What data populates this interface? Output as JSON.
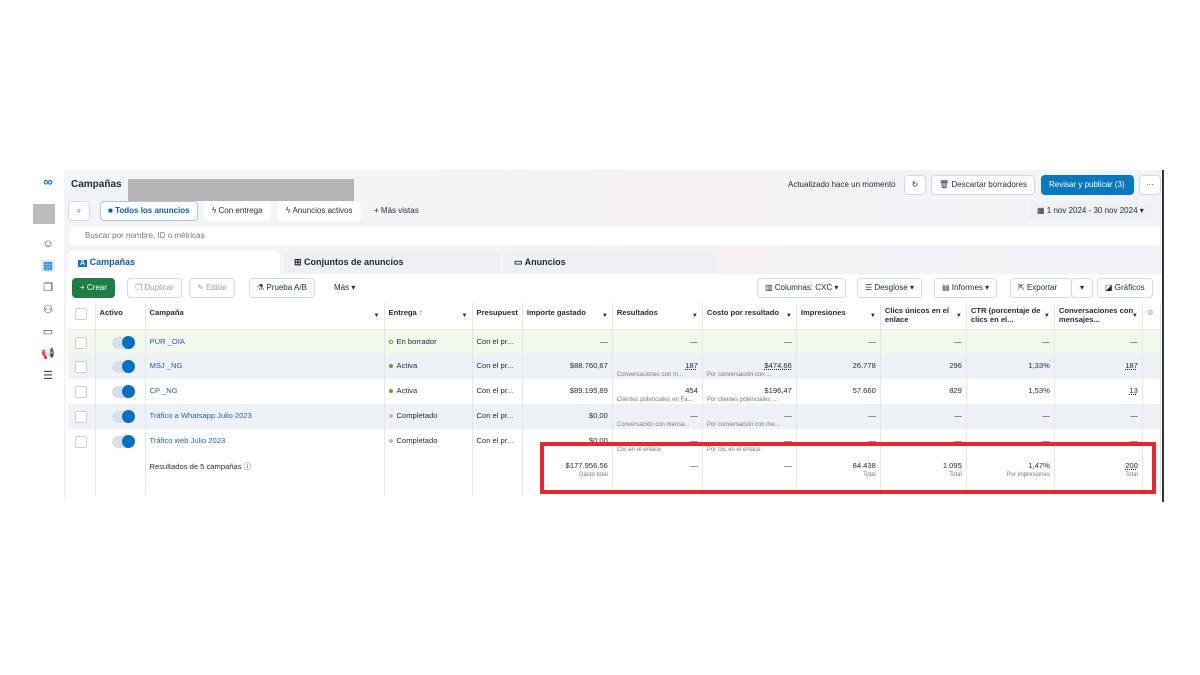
{
  "header": {
    "title": "Campañas",
    "updated": "Actualizado hace un momento",
    "discard": "Descartar borradores",
    "publish": "Revisar y publicar (3)",
    "more": "···"
  },
  "views": {
    "all": "Todos los anuncios",
    "delivering": "Con entrega",
    "active": "Anuncios activos",
    "more": "Más vistas"
  },
  "date_range": "1 nov 2024 - 30 nov 2024",
  "search": {
    "placeholder": "Buscar por nombre, ID o métricas"
  },
  "tabs": [
    "Campañas",
    "Conjuntos de anuncios",
    "Anuncios"
  ],
  "toolbar": {
    "create": "Crear",
    "duplicate": "Duplicar",
    "edit": "Editar",
    "ab": "Prueba A/B",
    "more": "Más",
    "columns": "Columnas: CXC",
    "breakdown": "Desglose",
    "reports": "Informes",
    "export": "Exportar",
    "charts": "Gráficos"
  },
  "columns": [
    "Activo",
    "Campaña",
    "Entrega",
    "Presupuest",
    "Importe gastado",
    "Resultados",
    "Costo por resultado",
    "Impresiones",
    "Clics únicos en el enlace",
    "CTR (porcentaje de clics en el...",
    "Conversaciones con mensajes..."
  ],
  "rows": [
    {
      "name": "PUR _OIA",
      "delivery": "En borrador",
      "budget": "Con el pr...",
      "spent": "—",
      "results": "—",
      "results_sub": "",
      "cost": "—",
      "cost_sub": "",
      "impr": "—",
      "clicks": "—",
      "ctr": "—",
      "conv": "—"
    },
    {
      "name": "MSJ _NG",
      "delivery": "Activa",
      "budget": "Con el pr...",
      "spent": "$88.760,67",
      "results": "187",
      "results_sub": "Conversaciones con m...",
      "cost": "$474,66",
      "cost_sub": "Por conversación con ...",
      "impr": "26.778",
      "clicks": "296",
      "ctr": "1,33%",
      "conv": "187"
    },
    {
      "name": "CP _NG",
      "delivery": "Activa",
      "budget": "Con el pr...",
      "spent": "$89.195,89",
      "results": "454",
      "results_sub": "Clientes potenciales en Fa...",
      "cost": "$196,47",
      "cost_sub": "Por clientes potenciales ...",
      "impr": "57.660",
      "clicks": "829",
      "ctr": "1,53%",
      "conv": "13"
    },
    {
      "name": "Tráfico a Whatsapp Julio 2023",
      "delivery": "Completado",
      "budget": "Con el pr...",
      "spent": "$0,00",
      "results": "—",
      "results_sub": "Conversación con mensa...",
      "cost": "—",
      "cost_sub": "Por conversación con me...",
      "impr": "—",
      "clicks": "—",
      "ctr": "—",
      "conv": "—"
    },
    {
      "name": "Tráfico web Julio 2023",
      "delivery": "Completado",
      "budget": "Con el pr...",
      "spent": "$0,00",
      "results": "—",
      "results_sub": "Clic en el enlace",
      "cost": "—",
      "cost_sub": "Por clic en el enlace",
      "impr": "—",
      "clicks": "—",
      "ctr": "—",
      "conv": "—"
    }
  ],
  "totals": {
    "label": "Resultados de 5 campañas",
    "spent": "$177.956,56",
    "spent_sub": "Gasto total",
    "results": "—",
    "cost": "—",
    "impr": "84.438",
    "impr_sub": "Total",
    "clicks": "1.095",
    "clicks_sub": "Total",
    "ctr": "1,47%",
    "ctr_sub": "Por impresiones",
    "conv": "200",
    "conv_sub": "Total"
  },
  "colors": {
    "accent": "#0a78be",
    "create": "#1e7e46",
    "highlight": "#e8262b",
    "active": "#5aa832"
  }
}
